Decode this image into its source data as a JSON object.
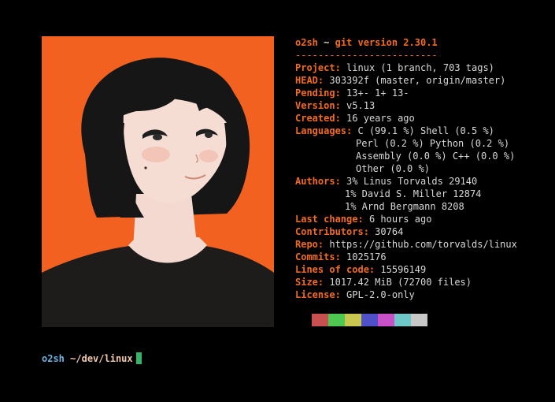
{
  "colors": {
    "background": "#000000",
    "accent": "#f26b1d",
    "text": "#d8d8d8",
    "portrait_bg": "#f2611f",
    "prompt_user": "#6fb3e0",
    "prompt_path": "#f0c8a8",
    "cursor": "#37b26b"
  },
  "info": {
    "title_user": "o2sh",
    "title_sep": "~",
    "title_text": "git version 2.30.1",
    "rule": "-------------------------",
    "rows": [
      {
        "label": "Project",
        "value": "linux (1 branch, 703 tags)"
      },
      {
        "label": "HEAD",
        "value": "303392f (master, origin/master)"
      },
      {
        "label": "Pending",
        "value": "13+- 1+ 13-"
      },
      {
        "label": "Version",
        "value": "v5.13"
      },
      {
        "label": "Created",
        "value": "16 years ago"
      },
      {
        "label": "Languages",
        "value": "C (99.1 %) Shell (0.5 %)"
      }
    ],
    "languages_more": [
      "Perl (0.2 %) Python (0.2 %)",
      "Assembly (0.0 %) C++ (0.0 %)",
      "Other (0.0 %)"
    ],
    "authors_label": "Authors",
    "authors": [
      "3% Linus Torvalds 29140",
      "1% David S. Miller 12874",
      "1% Arnd Bergmann 8208"
    ],
    "rows2": [
      {
        "label": "Last change",
        "value": "6 hours ago"
      },
      {
        "label": "Contributors",
        "value": "30764"
      },
      {
        "label": "Repo",
        "value": "https://github.com/torvalds/linux"
      },
      {
        "label": "Commits",
        "value": "1025176"
      },
      {
        "label": "Lines of code",
        "value": "15596149"
      },
      {
        "label": "Size",
        "value": "1017.42 MiB (72700 files)"
      },
      {
        "label": "License",
        "value": "GPL-2.0-only"
      }
    ]
  },
  "swatches": [
    "#c85050",
    "#4ec850",
    "#c8c850",
    "#5050c8",
    "#c850c8",
    "#6ec8c8",
    "#c8c8c8"
  ],
  "portrait": {
    "icon": "portrait-illustration"
  },
  "prompt": {
    "user": "o2sh",
    "path": "~/dev/linux"
  }
}
